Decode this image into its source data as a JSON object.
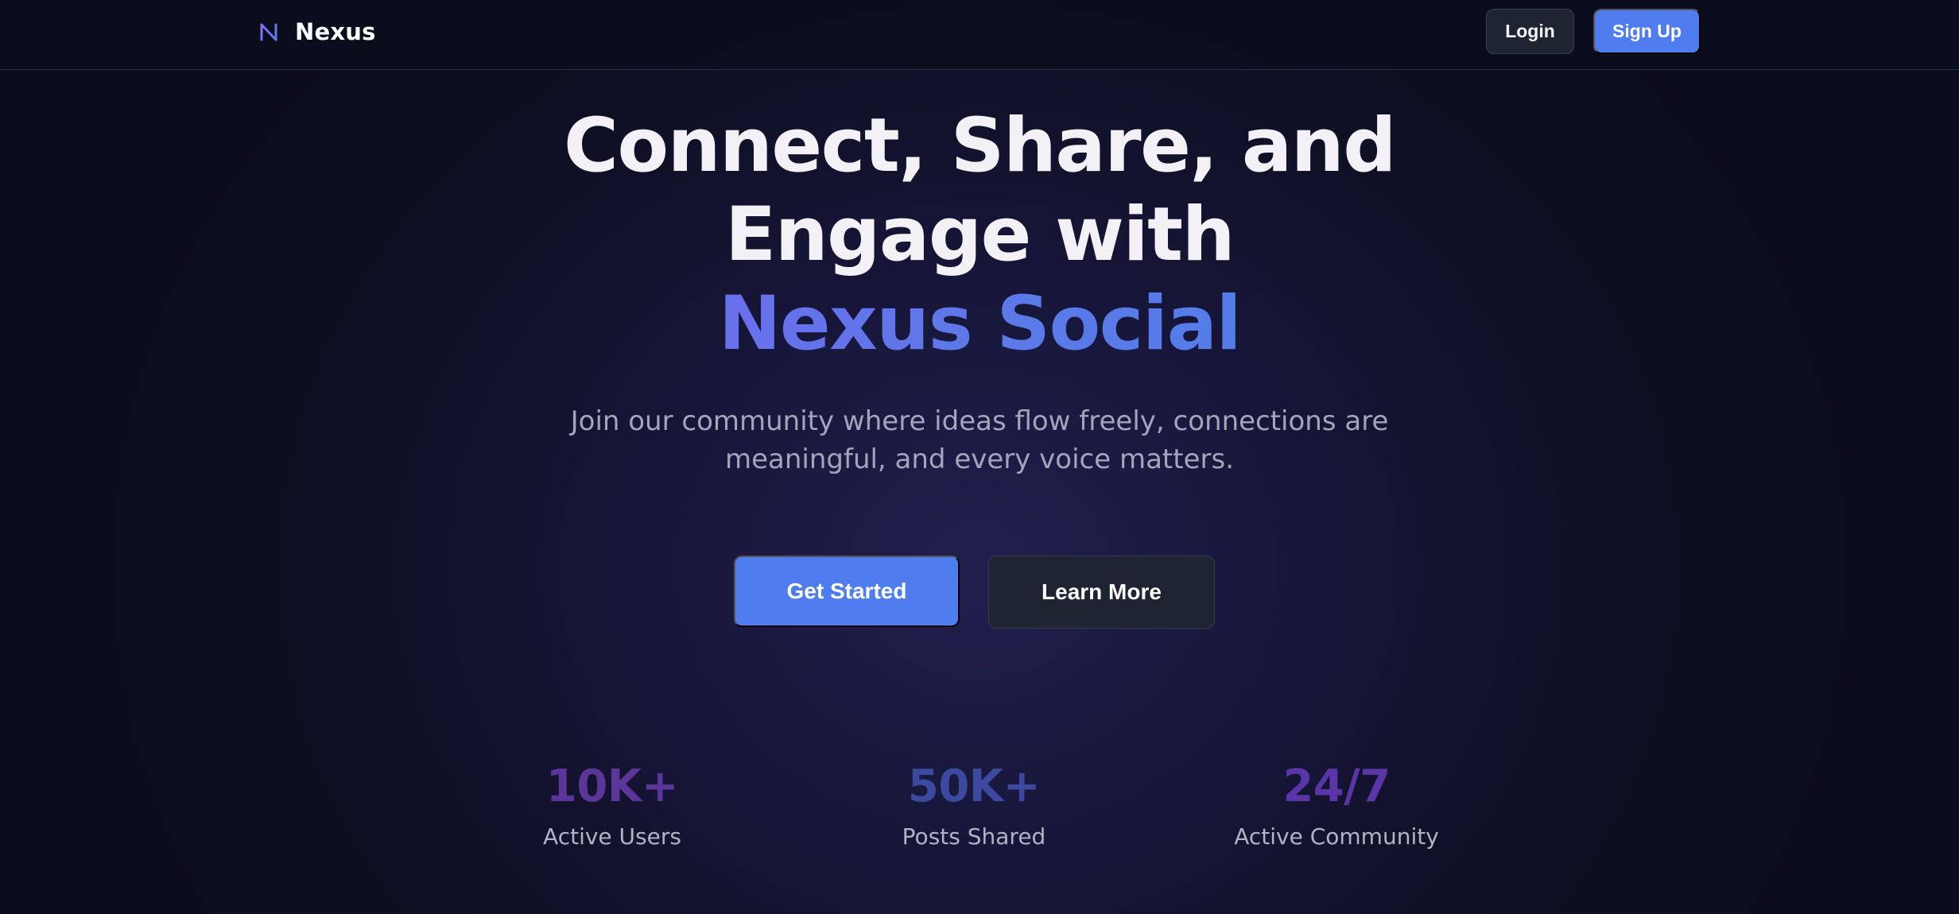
{
  "brand": {
    "name": "Nexus",
    "icon": "nexus-logo-icon"
  },
  "nav": {
    "login_label": "Login",
    "signup_label": "Sign Up"
  },
  "hero": {
    "title_line1": "Connect, Share, and",
    "title_line2": "Engage with",
    "title_accent": "Nexus Social",
    "subtitle_line1": "Join our community where ideas flow freely, connections are",
    "subtitle_line2": "meaningful, and every voice matters.",
    "primary_cta": "Get Started",
    "secondary_cta": "Learn More"
  },
  "stats": [
    {
      "value": "10K+",
      "label": "Active Users",
      "color": "#5b3599"
    },
    {
      "value": "50K+",
      "label": "Posts Shared",
      "color": "#3b4a9f"
    },
    {
      "value": "24/7",
      "label": "Active Community",
      "color": "#5a35a8"
    }
  ],
  "colors": {
    "accent": "#4f7df0",
    "background": "#0f1026",
    "title_gradient_start": "#7767ee",
    "title_gradient_end": "#4a7fe6"
  }
}
